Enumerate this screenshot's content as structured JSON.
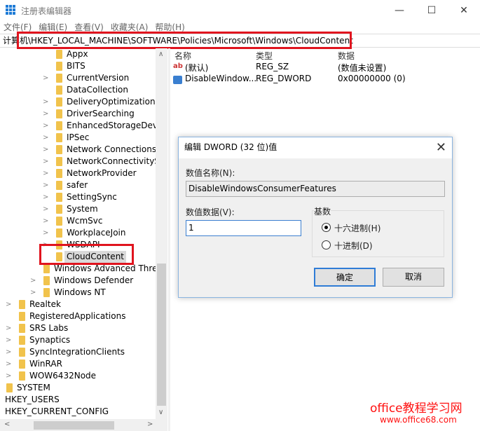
{
  "window": {
    "title": "注册表编辑器",
    "minimize": "—",
    "maximize": "☐",
    "close": "✕"
  },
  "menu": [
    "文件(F)",
    "编辑(E)",
    "查看(V)",
    "收藏夹(A)",
    "帮助(H)"
  ],
  "address": "计算机\\HKEY_LOCAL_MACHINE\\SOFTWARE\\Policies\\Microsoft\\Windows\\CloudContent",
  "tree": [
    {
      "label": "Appx",
      "level": 3,
      "exp": false
    },
    {
      "label": "BITS",
      "level": 3,
      "exp": false
    },
    {
      "label": "CurrentVersion",
      "level": 3,
      "exp": true
    },
    {
      "label": "DataCollection",
      "level": 3,
      "exp": false
    },
    {
      "label": "DeliveryOptimization",
      "level": 3,
      "exp": true
    },
    {
      "label": "DriverSearching",
      "level": 3,
      "exp": true
    },
    {
      "label": "EnhancedStorageDevic",
      "level": 3,
      "exp": true
    },
    {
      "label": "IPSec",
      "level": 3,
      "exp": true
    },
    {
      "label": "Network Connections",
      "level": 3,
      "exp": true
    },
    {
      "label": "NetworkConnectivitySt",
      "level": 3,
      "exp": true
    },
    {
      "label": "NetworkProvider",
      "level": 3,
      "exp": true
    },
    {
      "label": "safer",
      "level": 3,
      "exp": true
    },
    {
      "label": "SettingSync",
      "level": 3,
      "exp": true
    },
    {
      "label": "System",
      "level": 3,
      "exp": true
    },
    {
      "label": "WcmSvc",
      "level": 3,
      "exp": true
    },
    {
      "label": "WorkplaceJoin",
      "level": 3,
      "exp": true
    },
    {
      "label": "WSDAPI",
      "level": 3,
      "exp": true
    },
    {
      "label": "CloudContent",
      "level": 3,
      "exp": false,
      "selected": true
    },
    {
      "label": "Windows Advanced Threa",
      "level": 2,
      "exp": false
    },
    {
      "label": "Windows Defender",
      "level": 2,
      "exp": true
    },
    {
      "label": "Windows NT",
      "level": 2,
      "exp": true
    },
    {
      "label": "Realtek",
      "level": 1,
      "exp": true
    },
    {
      "label": "RegisteredApplications",
      "level": 1,
      "exp": false
    },
    {
      "label": "SRS Labs",
      "level": 1,
      "exp": true
    },
    {
      "label": "Synaptics",
      "level": 1,
      "exp": true
    },
    {
      "label": "SyncIntegrationClients",
      "level": 1,
      "exp": true
    },
    {
      "label": "WinRAR",
      "level": 1,
      "exp": true
    },
    {
      "label": "WOW6432Node",
      "level": 1,
      "exp": true
    },
    {
      "label": "SYSTEM",
      "level": 0,
      "exp": false
    },
    {
      "label": "HKEY_USERS",
      "level": -1,
      "exp": false
    },
    {
      "label": "HKEY_CURRENT_CONFIG",
      "level": -1,
      "exp": false
    }
  ],
  "list": {
    "headers": {
      "name": "名称",
      "type": "类型",
      "data": "数据"
    },
    "rows": [
      {
        "icon": "string-value-icon",
        "name": "(默认)",
        "type": "REG_SZ",
        "data": "(数值未设置)"
      },
      {
        "icon": "binary-value-icon",
        "name": "DisableWindow...",
        "type": "REG_DWORD",
        "data": "0x00000000 (0)"
      }
    ]
  },
  "dialog": {
    "title": "编辑 DWORD (32 位)值",
    "name_label": "数值名称(N):",
    "name_value": "DisableWindowsConsumerFeatures",
    "data_label": "数值数据(V):",
    "data_value": "1",
    "base_label": "基数",
    "hex_label": "十六进制(H)",
    "dec_label": "十进制(D)",
    "base_selected": "hex",
    "ok": "确定",
    "cancel": "取消"
  },
  "watermark": {
    "line1": "office教程学习网",
    "line2": "www.office68.com"
  },
  "colors": {
    "highlight": "#e0141e",
    "accent": "#2f7cd6",
    "folder": "#f1c34c"
  }
}
